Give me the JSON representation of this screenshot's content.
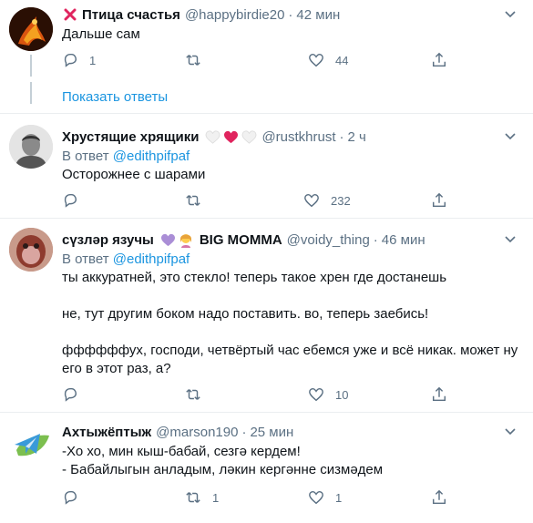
{
  "tweets": [
    {
      "name": "Птица счастья",
      "handle": "@happybirdie20",
      "sep": "·",
      "time": "42 мин",
      "text": [
        "Дальше сам"
      ],
      "reply_count": "1",
      "retweet_count": "",
      "like_count": "44"
    },
    {
      "name": "Хрустящие хрящики",
      "handle": "@rustkhrust",
      "sep": "·",
      "time": "2 ч",
      "reply_prefix": "В ответ",
      "reply_to": "@edithpifpaf",
      "text": [
        "Осторожнее с шарами"
      ],
      "reply_count": "",
      "retweet_count": "",
      "like_count": "232"
    },
    {
      "name": "сүзләр язучы",
      "name_suffix": "BIG MOMMA",
      "handle": "@voidy_thing",
      "sep": "·",
      "time": "46 мин",
      "reply_prefix": "В ответ",
      "reply_to": "@edithpifpaf",
      "text": [
        "ты аккуратней, это стекло! теперь такое хрен где достанешь",
        "не, тут другим боком надо поставить. во, теперь заебись!",
        "ффффффух, господи, четвёртый час ебемся уже и всё никак. может ну",
        "его в этот раз, а?"
      ],
      "reply_count": "",
      "retweet_count": "",
      "like_count": "10"
    },
    {
      "name": "Ахтыжёптыж",
      "handle": "@marson190",
      "sep": "·",
      "time": "25 мин",
      "text": [
        "-Хо хо, мин кыш-бабай, сезгә кердем!",
        "- Бабайлыгын анладым, ләкин кергәнне сизмәдем"
      ],
      "reply_count": "",
      "retweet_count": "1",
      "like_count": "1"
    }
  ],
  "show_replies_label": "Показать ответы",
  "colors": {
    "link": "#1b95e0",
    "muted": "#5b7083",
    "text": "#0f1419",
    "thread_line": "#c4cfd6",
    "divider": "#ebeef0",
    "red_x": "#e0245e"
  },
  "icons": {
    "reply": "reply-icon",
    "retweet": "retweet-icon",
    "like": "heart-icon",
    "share": "share-icon",
    "more": "chevron-down-icon"
  }
}
